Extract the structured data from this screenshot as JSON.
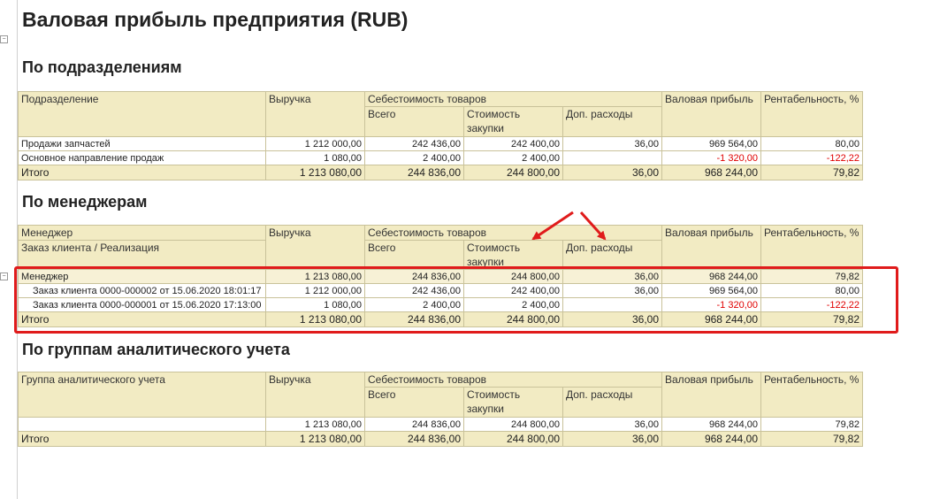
{
  "title": "Валовая прибыль предприятия (RUB)",
  "columns": {
    "revenue": "Выручка",
    "cost_group": "Себестоимость товаров",
    "cost_total": "Всего",
    "cost_purchase": "Стоимость закупки",
    "cost_extra": "Доп. расходы",
    "gross": "Валовая прибыль",
    "margin": "Рентабельность, %",
    "total_label": "Итого"
  },
  "section1": {
    "heading": "По подразделениям",
    "first_col": "Подразделение",
    "rows": [
      {
        "name": "Продажи запчастей",
        "revenue": "1 212 000,00",
        "cost_total": "242 436,00",
        "cost_purchase": "242 400,00",
        "cost_extra": "36,00",
        "gross": "969 564,00",
        "margin": "80,00"
      },
      {
        "name": "Основное направление продаж",
        "revenue": "1 080,00",
        "cost_total": "2 400,00",
        "cost_purchase": "2 400,00",
        "cost_extra": "",
        "gross": "-1 320,00",
        "margin": "-122,22"
      }
    ],
    "total": {
      "revenue": "1 213 080,00",
      "cost_total": "244 836,00",
      "cost_purchase": "244 800,00",
      "cost_extra": "36,00",
      "gross": "968 244,00",
      "margin": "79,82"
    }
  },
  "section2": {
    "heading": "По менеджерам",
    "first_col_1": "Менеджер",
    "first_col_2": "Заказ клиента / Реализация",
    "group": {
      "name": "Менеджер",
      "revenue": "1 213 080,00",
      "cost_total": "244 836,00",
      "cost_purchase": "244 800,00",
      "cost_extra": "36,00",
      "gross": "968 244,00",
      "margin": "79,82"
    },
    "rows": [
      {
        "name": "Заказ клиента 0000-000002 от 15.06.2020 18:01:17",
        "revenue": "1 212 000,00",
        "cost_total": "242 436,00",
        "cost_purchase": "242 400,00",
        "cost_extra": "36,00",
        "gross": "969 564,00",
        "margin": "80,00"
      },
      {
        "name": "Заказ клиента 0000-000001 от 15.06.2020 17:13:00",
        "revenue": "1 080,00",
        "cost_total": "2 400,00",
        "cost_purchase": "2 400,00",
        "cost_extra": "",
        "gross": "-1 320,00",
        "margin": "-122,22"
      }
    ],
    "total": {
      "revenue": "1 213 080,00",
      "cost_total": "244 836,00",
      "cost_purchase": "244 800,00",
      "cost_extra": "36,00",
      "gross": "968 244,00",
      "margin": "79,82"
    }
  },
  "section3": {
    "heading": "По группам аналитического учета",
    "first_col": "Группа аналитического учета",
    "rows": [
      {
        "name": "",
        "revenue": "1 213 080,00",
        "cost_total": "244 836,00",
        "cost_purchase": "244 800,00",
        "cost_extra": "36,00",
        "gross": "968 244,00",
        "margin": "79,82"
      }
    ],
    "total": {
      "revenue": "1 213 080,00",
      "cost_total": "244 836,00",
      "cost_purchase": "244 800,00",
      "cost_extra": "36,00",
      "gross": "968 244,00",
      "margin": "79,82"
    }
  },
  "colors": {
    "annotation": "#e01b1b",
    "header_bg": "#f2ebc3",
    "negative": "#e00000"
  }
}
